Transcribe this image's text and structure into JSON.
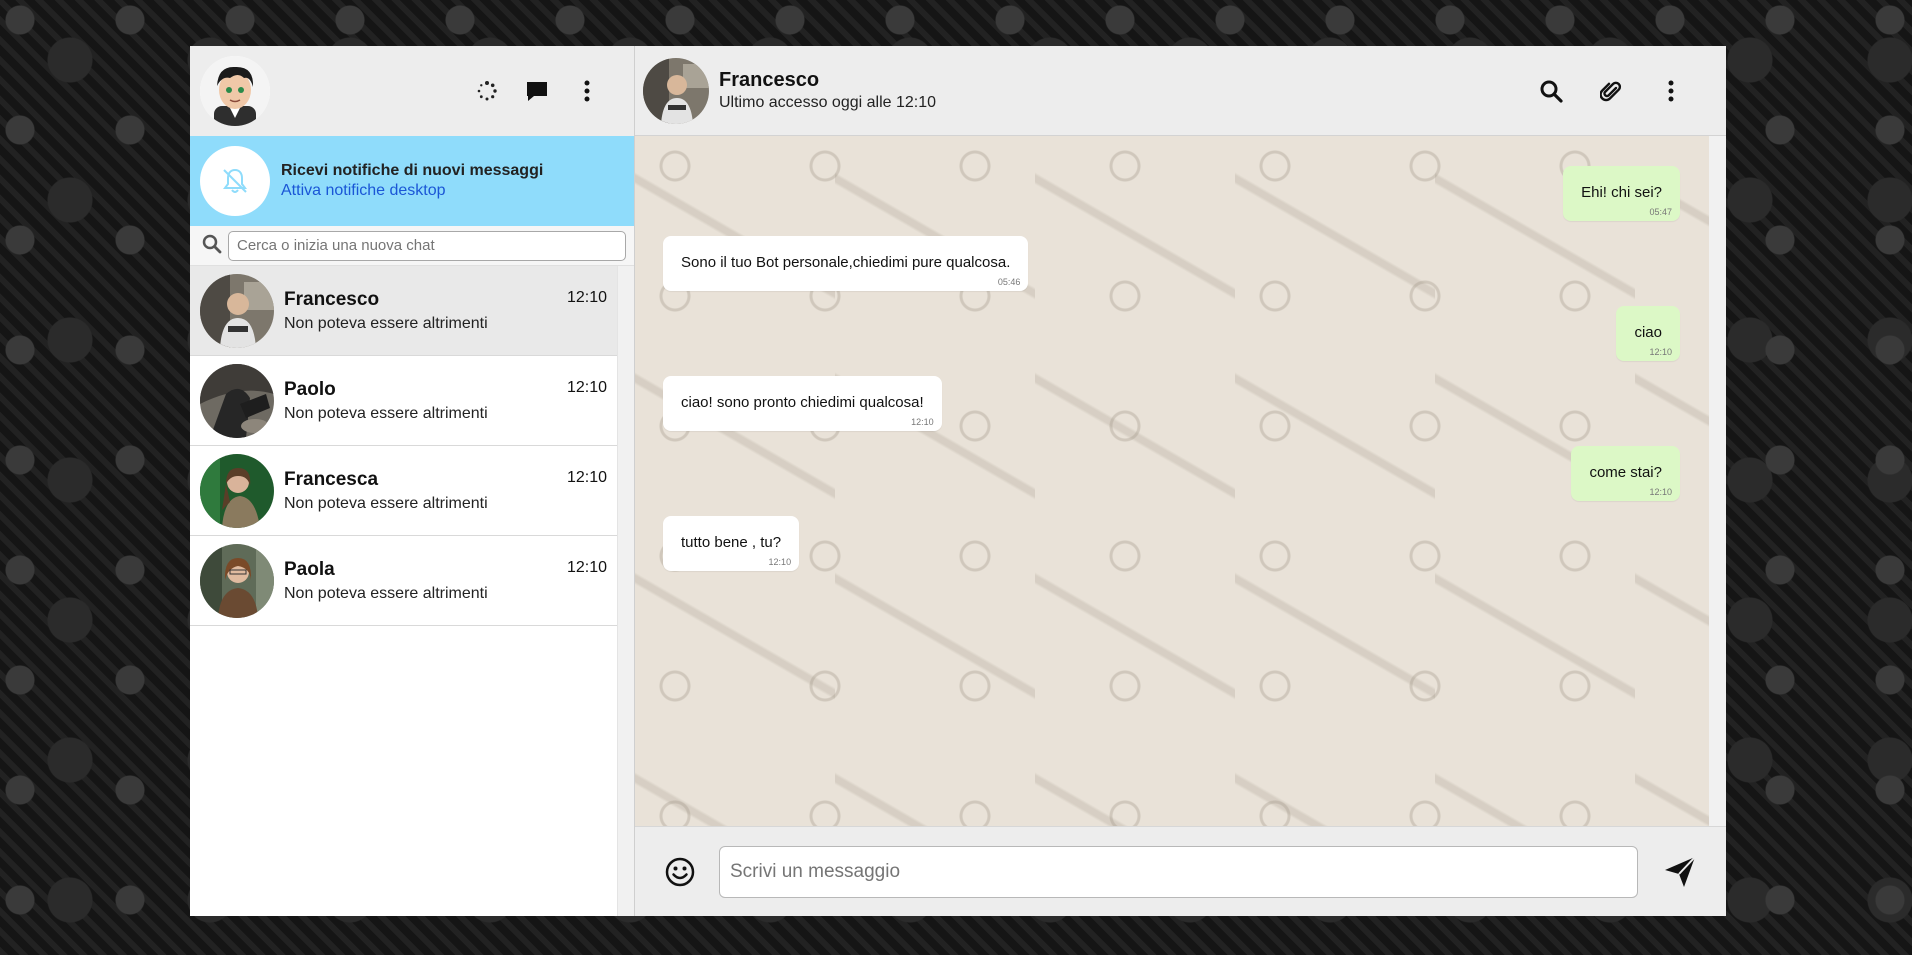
{
  "sidebar": {
    "notification": {
      "title": "Ricevi notifiche di nuovi messaggi",
      "link": "Attiva notifiche desktop"
    },
    "search": {
      "placeholder": "Cerca o inizia una nuova chat"
    },
    "chats": [
      {
        "name": "Francesco",
        "preview": "Non poteva essere altrimenti",
        "time": "12:10",
        "active": true
      },
      {
        "name": "Paolo",
        "preview": "Non poteva essere altrimenti",
        "time": "12:10",
        "active": false
      },
      {
        "name": "Francesca",
        "preview": "Non poteva essere altrimenti",
        "time": "12:10",
        "active": false
      },
      {
        "name": "Paola",
        "preview": "Non poteva essere altrimenti",
        "time": "12:10",
        "active": false
      }
    ]
  },
  "conversation": {
    "contact_name": "Francesco",
    "contact_status": "Ultimo accesso oggi alle 12:10",
    "messages": [
      {
        "direction": "out",
        "text": "Ehi! chi sei?",
        "time": "05:47"
      },
      {
        "direction": "in",
        "text": "Sono il tuo Bot personale,chiedimi pure qualcosa.",
        "time": "05:46"
      },
      {
        "direction": "out",
        "text": "ciao",
        "time": "12:10"
      },
      {
        "direction": "in",
        "text": "ciao! sono pronto chiedimi qualcosa!",
        "time": "12:10"
      },
      {
        "direction": "out",
        "text": "come stai?",
        "time": "12:10"
      },
      {
        "direction": "in",
        "text": "tutto bene , tu?",
        "time": "12:10"
      }
    ]
  },
  "composer": {
    "placeholder": "Scrivi un messaggio"
  },
  "colors": {
    "notification_bg": "#8fdcfb",
    "outgoing_bubble": "#dcf8c6",
    "incoming_bubble": "#ffffff",
    "header_bg": "#ededed",
    "link": "#1a56d6"
  },
  "icons": {
    "status": "loading-circle-icon",
    "new_chat": "message-icon",
    "menu": "more-vertical-icon",
    "notification_off": "bell-off-icon",
    "search": "search-icon",
    "attach": "paperclip-icon",
    "emoji": "smiley-icon",
    "send": "send-icon"
  }
}
